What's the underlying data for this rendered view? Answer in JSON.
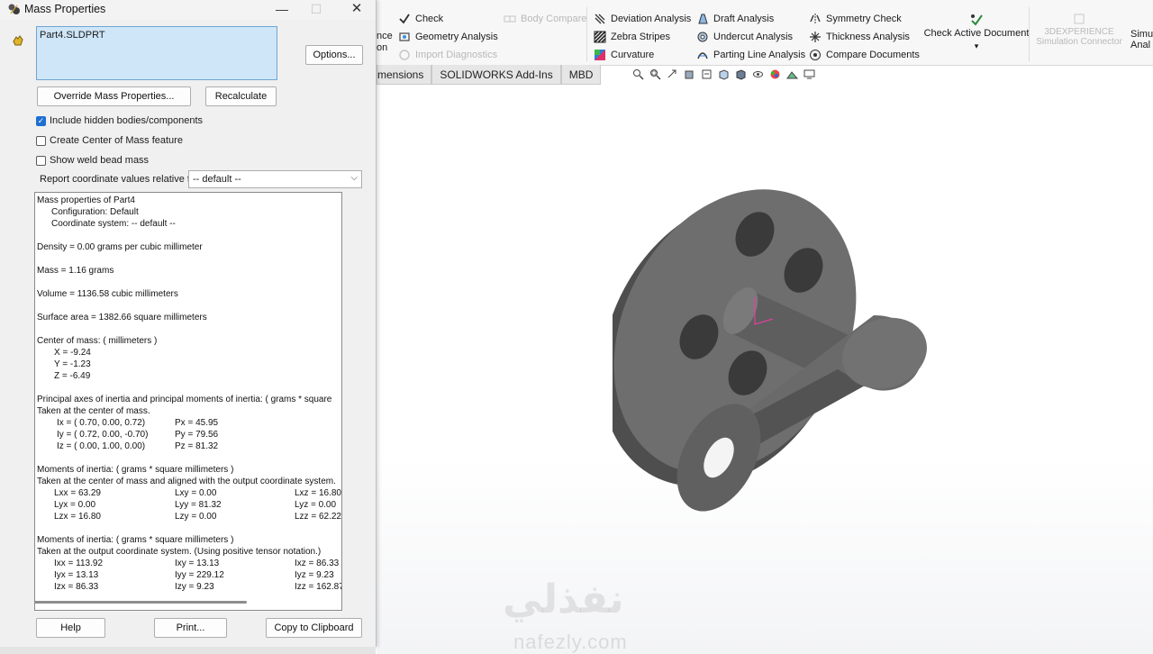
{
  "dialog": {
    "title": "Mass Properties",
    "selection": "Part4.SLDPRT",
    "buttons": {
      "options": "Options...",
      "override": "Override Mass Properties...",
      "recalculate": "Recalculate",
      "help": "Help",
      "print": "Print...",
      "copy": "Copy to Clipboard"
    },
    "checkboxes": [
      {
        "label": "Include hidden bodies/components",
        "checked": true
      },
      {
        "label": "Create Center of Mass feature",
        "checked": false
      },
      {
        "label": "Show weld bead mass",
        "checked": false
      }
    ],
    "report_label": "Report coordinate values relative to:",
    "report_value": "-- default --",
    "results": {
      "l1": "Mass properties of Part4",
      "l2": "Configuration: Default",
      "l3": "Coordinate system: -- default --",
      "density": "Density = 0.00 grams per cubic millimeter",
      "mass": "Mass = 1.16 grams",
      "volume": "Volume = 1136.58 cubic millimeters",
      "surface": "Surface area = 1382.66  square millimeters",
      "com_head": "Center of mass: ( millimeters )",
      "com_x": "X = -9.24",
      "com_y": "Y = -1.23",
      "com_z": "Z = -6.49",
      "pa_head": "Principal axes of inertia and principal moments of inertia: ( grams *  square",
      "pa_sub": "Taken at the center of mass.",
      "ix": "Ix = ( 0.70,  0.00,  0.72)",
      "iy": "Iy = ( 0.72,  0.00, -0.70)",
      "iz": "Iz = ( 0.00,  1.00,  0.00)",
      "px": "Px = 45.95",
      "py": "Py = 79.56",
      "pz": "Pz = 81.32",
      "mi1_head": "Moments of inertia: ( grams *  square millimeters )",
      "mi1_sub": "Taken at the center of mass and aligned with the output coordinate system.",
      "lxx": "Lxx = 63.29",
      "lxy": "Lxy = 0.00",
      "lxz": "Lxz = 16.80",
      "lyx": "Lyx = 0.00",
      "lyy": "Lyy = 81.32",
      "lyz": "Lyz = 0.00",
      "lzx": "Lzx = 16.80",
      "lzy": "Lzy = 0.00",
      "lzz": "Lzz = 62.22",
      "mi2_head": "Moments of inertia: ( grams *  square millimeters )",
      "mi2_sub": "Taken at the output coordinate system. (Using positive tensor notation.)",
      "ixx": "Ixx = 113.92",
      "ixy": "Ixy = 13.13",
      "ixz": "Ixz = 86.33",
      "iyx": "Iyx = 13.13",
      "iyy": "Iyy = 229.12",
      "iyz": "Iyz = 9.23",
      "izx": "Izx = 86.33",
      "izy": "Izy = 9.23",
      "izz": "Izz = 162.87"
    }
  },
  "ribbon": {
    "col0": [
      "nce",
      "on"
    ],
    "check": "Check",
    "geometry_analysis": "Geometry Analysis",
    "import_diagnostics": "Import Diagnostics",
    "body_compare": "Body Compare",
    "deviation_analysis": "Deviation Analysis",
    "zebra_stripes": "Zebra Stripes",
    "curvature": "Curvature",
    "draft_analysis": "Draft Analysis",
    "undercut_analysis": "Undercut Analysis",
    "parting_line_analysis": "Parting Line Analysis",
    "symmetry_check": "Symmetry Check",
    "thickness_analysis": "Thickness Analysis",
    "compare_documents": "Compare Documents",
    "check_active_document": "Check Active Document",
    "dropdown_glyph": "▾",
    "experience_1": "3DEXPERIENCE",
    "experience_2": "Simulation Connector",
    "simul_1": "Simul",
    "simul_2": "Anal"
  },
  "tabs": [
    "mensions",
    "SOLIDWORKS Add-Ins",
    "MBD"
  ],
  "watermark": {
    "arabic": "نفذلي",
    "latin": "nafezly.com"
  },
  "colors": {
    "selection_bg": "#cfe6f8",
    "checkbox_on": "#1e6fd0",
    "part_gray": "#6e6e6e"
  }
}
